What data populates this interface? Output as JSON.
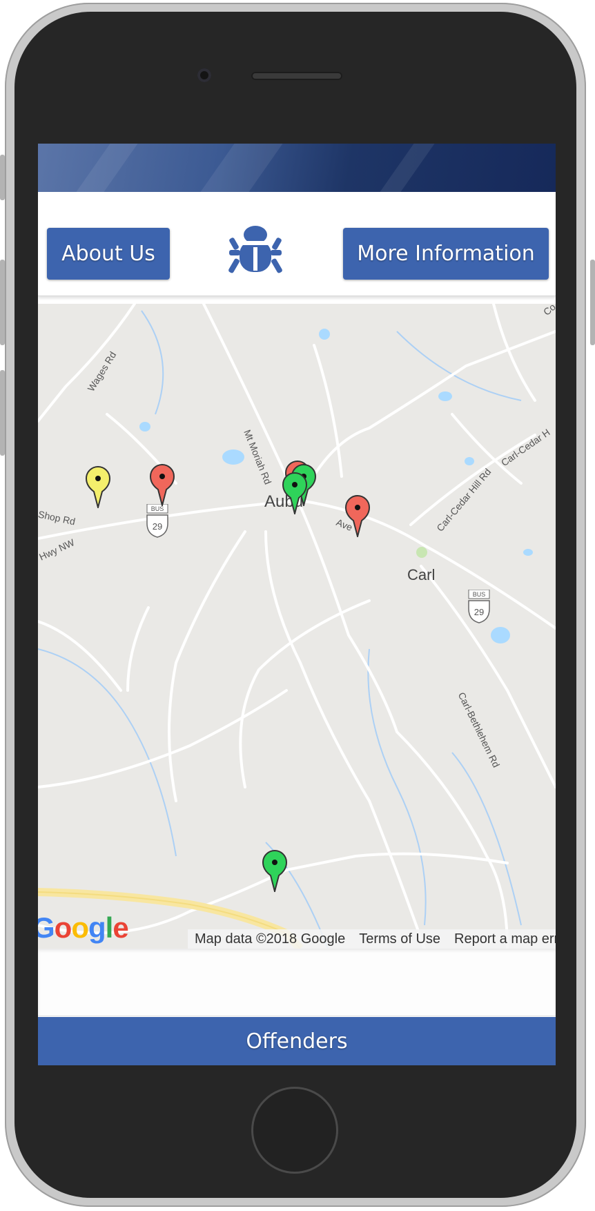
{
  "nav": {
    "about_label": "About Us",
    "more_label": "More Information",
    "logo_icon": "bug-icon"
  },
  "map": {
    "labels": {
      "wages_rd": "Wages Rd",
      "mt_moriah_rd": "Mt Moriah Rd",
      "auburn": "Aubu",
      "shop_rd": "Shop Rd",
      "hwy_nw": "Hwy NW",
      "ave": "Ave",
      "carl": "Carl",
      "carl_cedar_hill_rd": "Carl-Cedar Hill Rd",
      "carl_cedar_h": "Carl-Cedar H",
      "carl_bethlehem_rd": "Carl-Bethlehem Rd",
      "co": "Co",
      "bus": "BUS",
      "route": "29"
    },
    "zoom_in_label": "+",
    "zoom_out_label": "−",
    "attribution": {
      "map_data": "Map data ©2018 Google",
      "terms": "Terms of Use",
      "report": "Report a map err"
    },
    "logo_text": "Google",
    "marker_colors": {
      "yellow": "#f4ef6c",
      "red": "#f0675b",
      "green": "#2fd35a"
    }
  },
  "footer": {
    "label": "Offenders"
  }
}
